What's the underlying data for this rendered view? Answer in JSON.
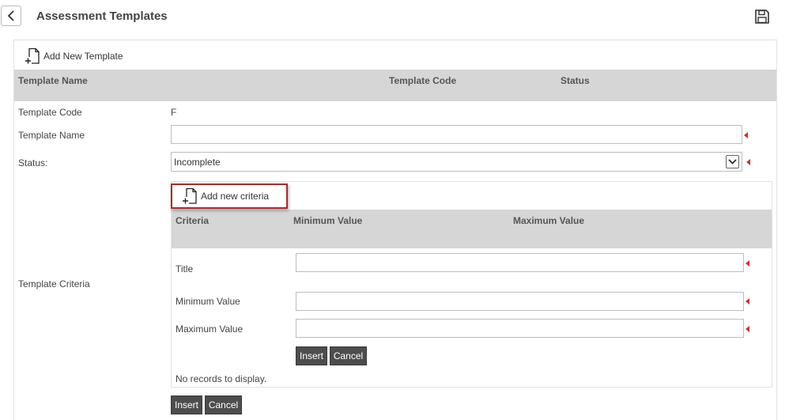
{
  "header": {
    "title": "Assessment Templates"
  },
  "toolbar": {
    "add_new_template": "Add New Template"
  },
  "grid": {
    "columns": [
      "Template Name",
      "Template Code",
      "Status"
    ]
  },
  "form": {
    "template_code_label": "Template Code",
    "template_code_value": "F",
    "template_name_label": "Template Name",
    "template_name_value": "",
    "status_label": "Status:",
    "status_value": "Incomplete",
    "criteria_label": "Template Criteria",
    "insert_label": "Insert",
    "cancel_label": "Cancel"
  },
  "criteria": {
    "add_new_criteria": "Add new criteria",
    "columns": [
      "Criteria",
      "Minimum Value",
      "Maximum Value"
    ],
    "title_label": "Title",
    "min_label": "Minimum Value",
    "max_label": "Maximum Value",
    "insert_label": "Insert",
    "cancel_label": "Cancel",
    "empty_message": "No records to display."
  },
  "colors": {
    "header_bg": "#d6d6d6",
    "button_bg": "#4d4d4d",
    "required": "#d32f2f",
    "highlight": "#a82a2a"
  }
}
